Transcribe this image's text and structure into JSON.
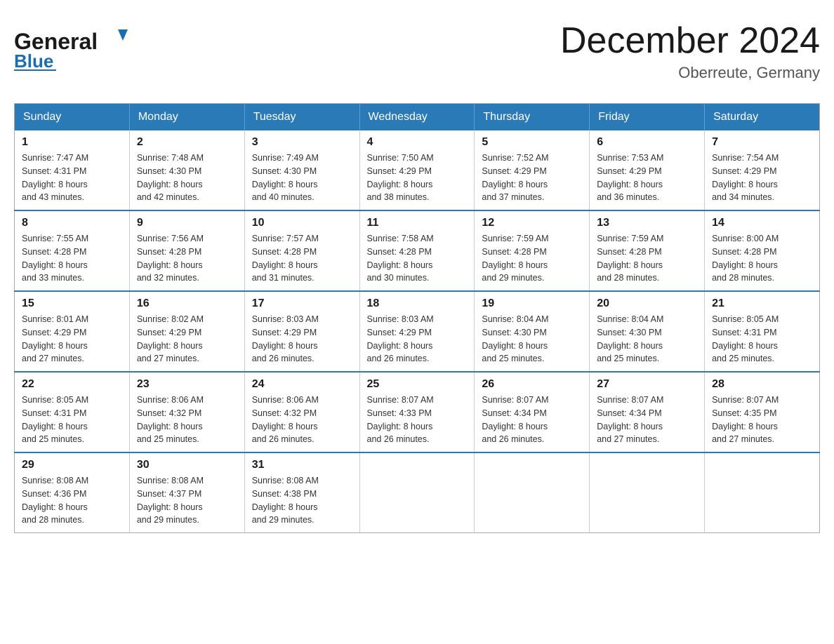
{
  "header": {
    "logo_general": "General",
    "logo_blue": "Blue",
    "month_title": "December 2024",
    "location": "Oberreute, Germany"
  },
  "days_of_week": [
    "Sunday",
    "Monday",
    "Tuesday",
    "Wednesday",
    "Thursday",
    "Friday",
    "Saturday"
  ],
  "weeks": [
    [
      {
        "day": "1",
        "sunrise": "7:47 AM",
        "sunset": "4:31 PM",
        "daylight": "8 hours and 43 minutes."
      },
      {
        "day": "2",
        "sunrise": "7:48 AM",
        "sunset": "4:30 PM",
        "daylight": "8 hours and 42 minutes."
      },
      {
        "day": "3",
        "sunrise": "7:49 AM",
        "sunset": "4:30 PM",
        "daylight": "8 hours and 40 minutes."
      },
      {
        "day": "4",
        "sunrise": "7:50 AM",
        "sunset": "4:29 PM",
        "daylight": "8 hours and 38 minutes."
      },
      {
        "day": "5",
        "sunrise": "7:52 AM",
        "sunset": "4:29 PM",
        "daylight": "8 hours and 37 minutes."
      },
      {
        "day": "6",
        "sunrise": "7:53 AM",
        "sunset": "4:29 PM",
        "daylight": "8 hours and 36 minutes."
      },
      {
        "day": "7",
        "sunrise": "7:54 AM",
        "sunset": "4:29 PM",
        "daylight": "8 hours and 34 minutes."
      }
    ],
    [
      {
        "day": "8",
        "sunrise": "7:55 AM",
        "sunset": "4:28 PM",
        "daylight": "8 hours and 33 minutes."
      },
      {
        "day": "9",
        "sunrise": "7:56 AM",
        "sunset": "4:28 PM",
        "daylight": "8 hours and 32 minutes."
      },
      {
        "day": "10",
        "sunrise": "7:57 AM",
        "sunset": "4:28 PM",
        "daylight": "8 hours and 31 minutes."
      },
      {
        "day": "11",
        "sunrise": "7:58 AM",
        "sunset": "4:28 PM",
        "daylight": "8 hours and 30 minutes."
      },
      {
        "day": "12",
        "sunrise": "7:59 AM",
        "sunset": "4:28 PM",
        "daylight": "8 hours and 29 minutes."
      },
      {
        "day": "13",
        "sunrise": "7:59 AM",
        "sunset": "4:28 PM",
        "daylight": "8 hours and 28 minutes."
      },
      {
        "day": "14",
        "sunrise": "8:00 AM",
        "sunset": "4:28 PM",
        "daylight": "8 hours and 28 minutes."
      }
    ],
    [
      {
        "day": "15",
        "sunrise": "8:01 AM",
        "sunset": "4:29 PM",
        "daylight": "8 hours and 27 minutes."
      },
      {
        "day": "16",
        "sunrise": "8:02 AM",
        "sunset": "4:29 PM",
        "daylight": "8 hours and 27 minutes."
      },
      {
        "day": "17",
        "sunrise": "8:03 AM",
        "sunset": "4:29 PM",
        "daylight": "8 hours and 26 minutes."
      },
      {
        "day": "18",
        "sunrise": "8:03 AM",
        "sunset": "4:29 PM",
        "daylight": "8 hours and 26 minutes."
      },
      {
        "day": "19",
        "sunrise": "8:04 AM",
        "sunset": "4:30 PM",
        "daylight": "8 hours and 25 minutes."
      },
      {
        "day": "20",
        "sunrise": "8:04 AM",
        "sunset": "4:30 PM",
        "daylight": "8 hours and 25 minutes."
      },
      {
        "day": "21",
        "sunrise": "8:05 AM",
        "sunset": "4:31 PM",
        "daylight": "8 hours and 25 minutes."
      }
    ],
    [
      {
        "day": "22",
        "sunrise": "8:05 AM",
        "sunset": "4:31 PM",
        "daylight": "8 hours and 25 minutes."
      },
      {
        "day": "23",
        "sunrise": "8:06 AM",
        "sunset": "4:32 PM",
        "daylight": "8 hours and 25 minutes."
      },
      {
        "day": "24",
        "sunrise": "8:06 AM",
        "sunset": "4:32 PM",
        "daylight": "8 hours and 26 minutes."
      },
      {
        "day": "25",
        "sunrise": "8:07 AM",
        "sunset": "4:33 PM",
        "daylight": "8 hours and 26 minutes."
      },
      {
        "day": "26",
        "sunrise": "8:07 AM",
        "sunset": "4:34 PM",
        "daylight": "8 hours and 26 minutes."
      },
      {
        "day": "27",
        "sunrise": "8:07 AM",
        "sunset": "4:34 PM",
        "daylight": "8 hours and 27 minutes."
      },
      {
        "day": "28",
        "sunrise": "8:07 AM",
        "sunset": "4:35 PM",
        "daylight": "8 hours and 27 minutes."
      }
    ],
    [
      {
        "day": "29",
        "sunrise": "8:08 AM",
        "sunset": "4:36 PM",
        "daylight": "8 hours and 28 minutes."
      },
      {
        "day": "30",
        "sunrise": "8:08 AM",
        "sunset": "4:37 PM",
        "daylight": "8 hours and 29 minutes."
      },
      {
        "day": "31",
        "sunrise": "8:08 AM",
        "sunset": "4:38 PM",
        "daylight": "8 hours and 29 minutes."
      },
      null,
      null,
      null,
      null
    ]
  ],
  "labels": {
    "sunrise": "Sunrise:",
    "sunset": "Sunset:",
    "daylight": "Daylight:"
  },
  "colors": {
    "header_bg": "#2a7ab8",
    "border_accent": "#2a7ab8"
  }
}
